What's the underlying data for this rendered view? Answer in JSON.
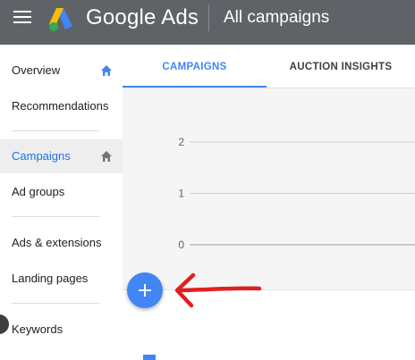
{
  "header": {
    "brand": "Google Ads",
    "title": "All campaigns",
    "menu_icon": "hamburger-menu-icon",
    "logo_icon": "google-ads-logo"
  },
  "sidebar": {
    "items": [
      {
        "label": "Overview",
        "icon": "home-icon",
        "active": false
      },
      {
        "label": "Recommendations",
        "active": false
      },
      {
        "label": "Campaigns",
        "icon": "home-icon",
        "active": true
      },
      {
        "label": "Ad groups",
        "active": false
      },
      {
        "label": "Ads & extensions",
        "active": false
      },
      {
        "label": "Landing pages",
        "active": false
      },
      {
        "label": "Keywords",
        "active": false
      }
    ]
  },
  "tabs": [
    {
      "label": "CAMPAIGNS",
      "active": true
    },
    {
      "label": "AUCTION INSIGHTS",
      "active": false
    }
  ],
  "chart_data": {
    "type": "line",
    "y_ticks": [
      "2",
      "1",
      "0"
    ],
    "ylim": [
      0,
      2
    ],
    "grid": true,
    "series": []
  },
  "fab": {
    "icon": "plus-icon"
  },
  "colors": {
    "topbar": "#5f6368",
    "accent": "#4285f4",
    "annotation": "#e02020",
    "active_nav_bg": "#eeeeee"
  }
}
